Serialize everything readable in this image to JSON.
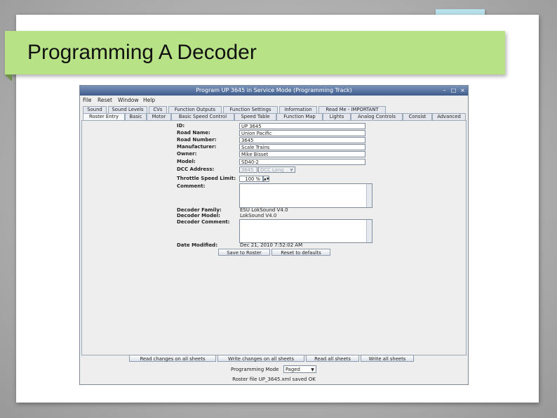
{
  "slide": {
    "title": "Programming A Decoder"
  },
  "window": {
    "title": "Program UP 3645 in Service Mode (Programming Track)",
    "controls": {
      "minimize": "–",
      "maximize": "□",
      "close": "×"
    },
    "menu": [
      "File",
      "Reset",
      "Window",
      "Help"
    ],
    "tabs_row1": [
      "Sound",
      "Sound Levels",
      "CVs",
      "Function Outputs",
      "Function Settings",
      "Information",
      "Read Me - IMPORTANT"
    ],
    "tabs_row2": [
      "Roster Entry",
      "Basic",
      "Motor",
      "Basic Speed Control",
      "Speed Table",
      "Function Map",
      "Lights",
      "Analog Controls",
      "Consist",
      "Advanced"
    ],
    "roster": {
      "labels": {
        "id": "ID:",
        "road_name": "Road Name:",
        "road_number": "Road Number:",
        "manufacturer": "Manufacturer:",
        "owner": "Owner:",
        "model": "Model:",
        "dcc_address": "DCC Address:",
        "throttle_speed_limit": "Throttle Speed Limit:",
        "comment": "Comment:",
        "decoder_family": "Decoder Family:",
        "decoder_model": "Decoder Model:",
        "decoder_comment": "Decoder Comment:",
        "date_modified": "Date Modified:"
      },
      "values": {
        "id": "UP 3645",
        "road_name": "Union Pacific",
        "road_number": "3645",
        "manufacturer": "Scale Trains",
        "owner": "Mike Bisset",
        "model": "SD40-2",
        "dcc_address": "3645",
        "dcc_type": "DCC Long",
        "throttle_speed_limit": "100 %",
        "decoder_family": "ESU LokSound V4.0",
        "decoder_model": "LokSound V4.0",
        "date_modified": "Dec 21, 2010 7:52:02 AM"
      },
      "buttons": {
        "save": "Save to Roster",
        "reset": "Reset to defaults"
      }
    },
    "bottom_buttons": [
      "Read changes on all sheets",
      "Write changes on all sheets",
      "Read all sheets",
      "Write all sheets"
    ],
    "programming_mode": {
      "label": "Programming Mode",
      "value": "Paged"
    },
    "status": "Roster file UP_3645.xml saved OK"
  }
}
